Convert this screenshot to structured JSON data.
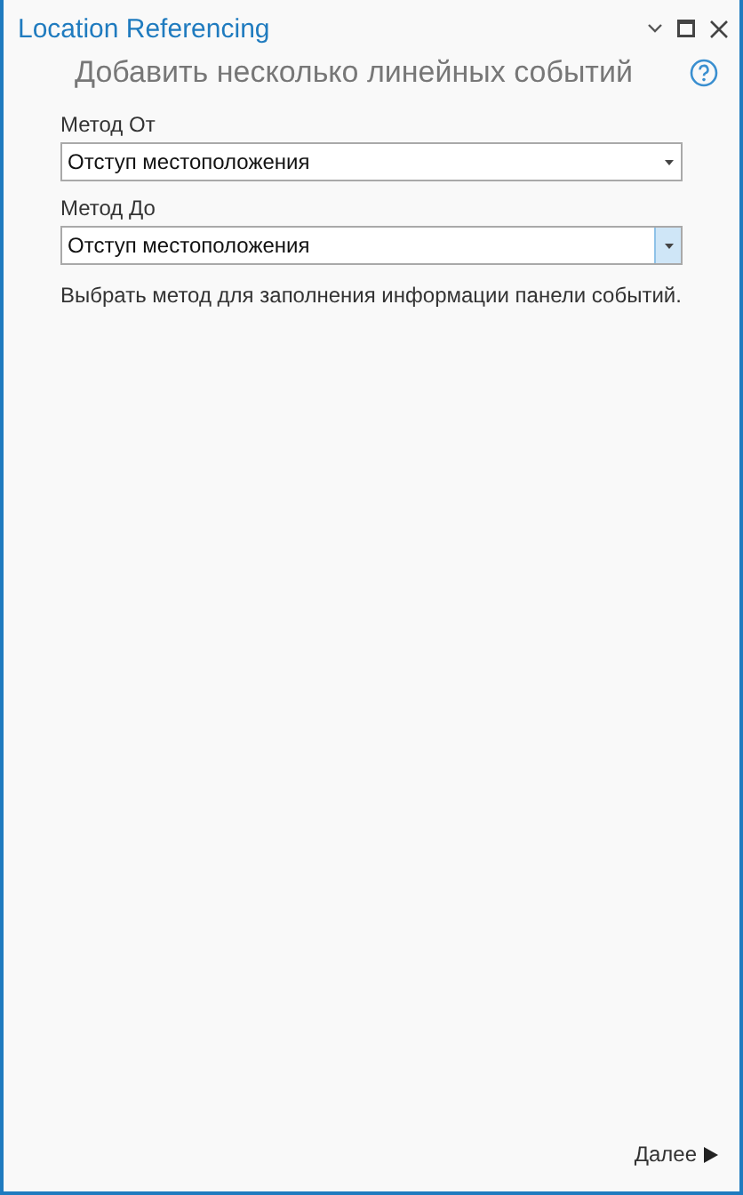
{
  "window": {
    "title": "Location Referencing"
  },
  "heading": "Добавить несколько линейных событий",
  "fields": [
    {
      "label": "Метод От",
      "value": "Отступ местоположения",
      "highlighted": false
    },
    {
      "label": "Метод До",
      "value": "Отступ местоположения",
      "highlighted": true
    }
  ],
  "hint": "Выбрать метод для заполнения информации панели событий.",
  "next_button": {
    "label": "Далее"
  }
}
